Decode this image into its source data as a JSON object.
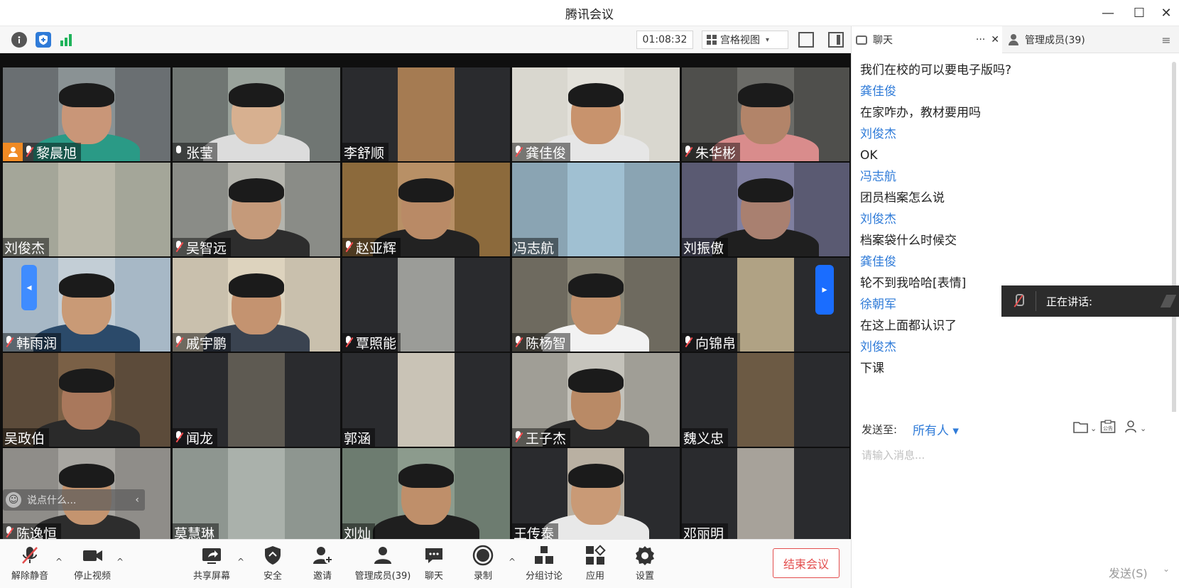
{
  "window": {
    "title": "腾讯会议",
    "minimize": "—",
    "maximize": "☐",
    "close": "✕"
  },
  "topbar": {
    "timer": "01:08:32",
    "view_mode": "宫格视图",
    "view_caret": "▾"
  },
  "colors": {
    "accent": "#2f7bd8",
    "end_red": "#e34d4d",
    "host_orange": "#f08a24",
    "pager_blue": "#1a6dff"
  },
  "participants": [
    {
      "name": "黎晨旭",
      "mic": "muted",
      "host": true,
      "bg": "#6a6f72",
      "strip": "#8a9294",
      "skin": "#c99678",
      "shirt": "#2a9a86"
    },
    {
      "name": "张莹",
      "mic": "on",
      "host": false,
      "bg": "#707673",
      "strip": "#9aa39c",
      "skin": "#d7b090",
      "shirt": "#dcdcdc"
    },
    {
      "name": "李舒顺",
      "mic": "none",
      "host": false,
      "bg": "#2a2b2e",
      "strip": "#a57b52",
      "skin": "",
      "shirt": ""
    },
    {
      "name": "龚佳俊",
      "mic": "muted",
      "host": false,
      "bg": "#d9d7cf",
      "strip": "#e3e1da",
      "skin": "#c8936d",
      "shirt": "#e6e6e6"
    },
    {
      "name": "朱华彬",
      "mic": "muted",
      "host": false,
      "bg": "#4f4f4c",
      "strip": "#6b6b67",
      "skin": "#b28469",
      "shirt": "#d98c8c"
    },
    {
      "name": "刘俊杰",
      "mic": "none",
      "host": false,
      "bg": "#a4a699",
      "strip": "#bab8aa",
      "skin": "",
      "shirt": ""
    },
    {
      "name": "吴智远",
      "mic": "muted",
      "host": false,
      "bg": "#8a8c87",
      "strip": "#b4b4ad",
      "skin": "#c59a7a",
      "shirt": "#2d2d2d"
    },
    {
      "name": "赵亚辉",
      "mic": "muted",
      "host": false,
      "bg": "#8c6a3c",
      "strip": "#b89066",
      "skin": "#b98a66",
      "shirt": "#222"
    },
    {
      "name": "冯志航",
      "mic": "none",
      "host": false,
      "bg": "#8aa4b3",
      "strip": "#a0c0d2",
      "skin": "",
      "shirt": ""
    },
    {
      "name": "刘振傲",
      "mic": "none",
      "host": false,
      "bg": "#5a5a72",
      "strip": "#7f7fa0",
      "skin": "#a98070",
      "shirt": "#1f1f1f"
    },
    {
      "name": "韩雨润",
      "mic": "muted",
      "host": false,
      "bg": "#a7b8c6",
      "strip": "#c3ced6",
      "skin": "#c99a76",
      "shirt": "#2b4a6a"
    },
    {
      "name": "戚宇鹏",
      "mic": "muted",
      "host": false,
      "bg": "#c9c0ad",
      "strip": "#ddd3be",
      "skin": "#c49370",
      "shirt": "#3a4350"
    },
    {
      "name": "覃照能",
      "mic": "muted",
      "host": false,
      "bg": "#2a2b2e",
      "strip": "#9b9c98",
      "skin": "",
      "shirt": ""
    },
    {
      "name": "陈杨智",
      "mic": "muted",
      "host": false,
      "bg": "#6e6a5f",
      "strip": "#8b8778",
      "skin": "#c0906c",
      "shirt": "#f2f2f2"
    },
    {
      "name": "向锦帛",
      "mic": "muted",
      "host": false,
      "bg": "#2a2b2e",
      "strip": "#b0a284",
      "skin": "",
      "shirt": ""
    },
    {
      "name": "吴政伯",
      "mic": "none",
      "host": false,
      "bg": "#5c4b3a",
      "strip": "#7a6046",
      "skin": "#a9785c",
      "shirt": "#2a2a2a"
    },
    {
      "name": "闻龙",
      "mic": "muted",
      "host": false,
      "bg": "#2a2b2e",
      "strip": "#5e5a52",
      "skin": "",
      "shirt": ""
    },
    {
      "name": "郭涵",
      "mic": "none",
      "host": false,
      "bg": "#2a2b2e",
      "strip": "#c9c3b6",
      "skin": "",
      "shirt": ""
    },
    {
      "name": "王子杰",
      "mic": "muted",
      "host": false,
      "bg": "#a09e96",
      "strip": "#c4c2ba",
      "skin": "#b98a66",
      "shirt": "#2a2a2a"
    },
    {
      "name": "魏义忠",
      "mic": "none",
      "host": false,
      "bg": "#2a2b2e",
      "strip": "#6c5a44",
      "skin": "",
      "shirt": ""
    },
    {
      "name": "陈逸恒",
      "mic": "muted",
      "host": false,
      "bg": "#8f8d89",
      "strip": "#a8a6a1",
      "skin": "#c4946f",
      "shirt": "#2d2d2d"
    },
    {
      "name": "莫慧琳",
      "mic": "none",
      "host": false,
      "bg": "#8e9690",
      "strip": "#aab1ab",
      "skin": "",
      "shirt": ""
    },
    {
      "name": "刘灿",
      "mic": "none",
      "host": false,
      "bg": "#6d7c70",
      "strip": "#8c9b8d",
      "skin": "#bf8f6a",
      "shirt": "#1f1f1f"
    },
    {
      "name": "王传泰",
      "mic": "none",
      "host": false,
      "bg": "#2a2b2e",
      "strip": "#b9b0a2",
      "skin": "#c99a76",
      "shirt": "#e8e8e8"
    },
    {
      "name": "邓丽明",
      "mic": "none",
      "host": false,
      "bg": "#2a2b2e",
      "strip": "#a7a29a",
      "skin": "",
      "shirt": ""
    }
  ],
  "overlay": {
    "chat_placeholder": "说点什么...",
    "collapse": "‹",
    "pager_left": "◂",
    "pager_right": "▸"
  },
  "toolbar": {
    "unmute": "解除静音",
    "stop_video": "停止视频",
    "share_screen": "共享屏幕",
    "security": "安全",
    "invite": "邀请",
    "members": "管理成员(39)",
    "chat": "聊天",
    "record": "录制",
    "breakout": "分组讨论",
    "apps": "应用",
    "settings": "设置",
    "end_meeting": "结束会议",
    "expand": "^"
  },
  "panel": {
    "tab_chat": "聊天",
    "tab_more": "···",
    "tab_close": "✕",
    "tab_members": "管理成员(39)",
    "menu": "≡"
  },
  "messages": [
    {
      "type": "text",
      "content": "我们在校的可以要电子版吗?"
    },
    {
      "type": "sender",
      "content": "龚佳俊"
    },
    {
      "type": "text",
      "content": "在家咋办，教材要用吗"
    },
    {
      "type": "sender",
      "content": "刘俊杰"
    },
    {
      "type": "text",
      "content": "OK"
    },
    {
      "type": "sender",
      "content": "冯志航"
    },
    {
      "type": "text",
      "content": "团员档案怎么说"
    },
    {
      "type": "sender",
      "content": "刘俊杰"
    },
    {
      "type": "text",
      "content": "档案袋什么时候交"
    },
    {
      "type": "sender",
      "content": "龚佳俊"
    },
    {
      "type": "text",
      "content": "轮不到我哈哈[表情]"
    },
    {
      "type": "sender",
      "content": "徐朝军"
    },
    {
      "type": "text",
      "content": "在这上面都认识了"
    },
    {
      "type": "sender",
      "content": "刘俊杰"
    },
    {
      "type": "text",
      "content": "下课"
    }
  ],
  "speaking": {
    "label": "正在讲话:"
  },
  "send": {
    "to_label": "发送至:",
    "to_value": "所有人 ▾",
    "placeholder": "请输入消息...",
    "send_button": "发送(S)",
    "send_caret": "⌄",
    "tool_caret": "⌄",
    "notice_text": "公告"
  }
}
